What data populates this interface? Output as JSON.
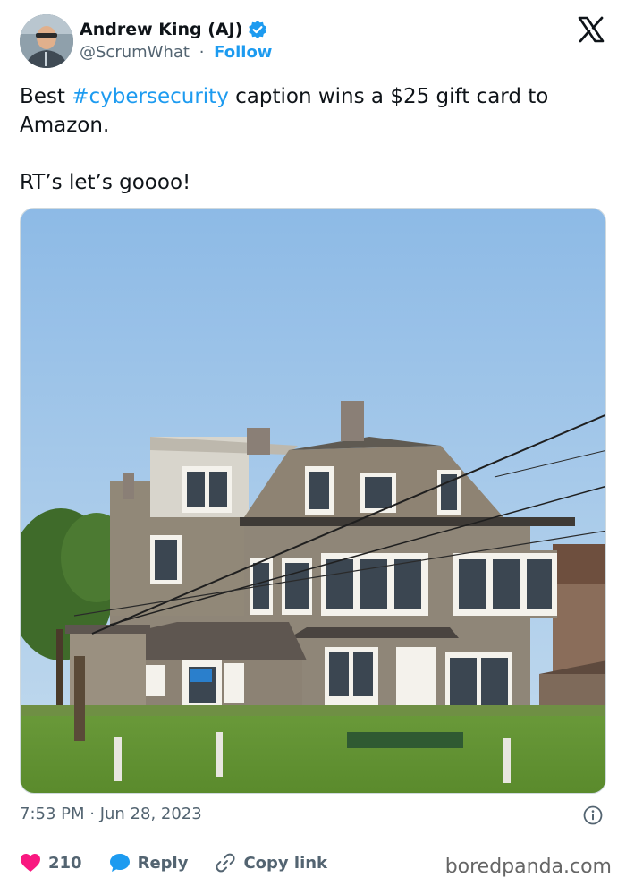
{
  "author": {
    "name": "Andrew King (AJ)",
    "handle": "@ScrumWhat",
    "separator": "·",
    "follow_label": "Follow",
    "verified_color": "#1d9bf0"
  },
  "platform_icon": "x-logo-icon",
  "tweet": {
    "text_before": "Best ",
    "hashtag": "#cybersecurity",
    "text_after": " caption wins a $25 gift card to Amazon.",
    "line2": "RT’s let’s goooo!"
  },
  "timestamp": "7:53 PM · Jun 28, 2023",
  "actions": {
    "like_count": "210",
    "reply_label": "Reply",
    "copy_label": "Copy link"
  },
  "watermark": "boredpanda.com",
  "colors": {
    "accent": "#1d9bf0",
    "like": "#f91880",
    "text": "#0f1419",
    "muted": "#536471"
  }
}
